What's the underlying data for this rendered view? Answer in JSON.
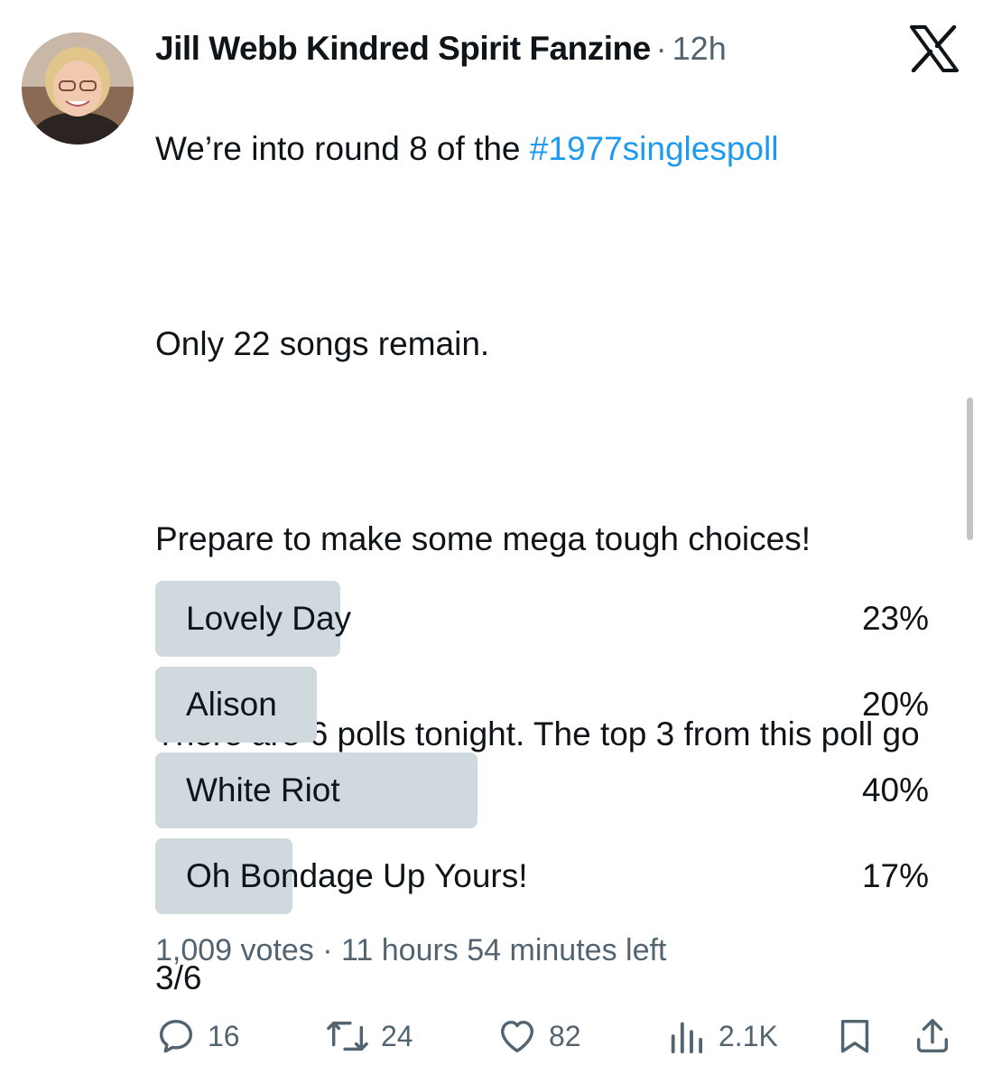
{
  "author": {
    "display_name": "Jill Webb Kindred Spirit Fanzine",
    "separator": "·",
    "time": "12h",
    "avatar_icon": "avatar-photo"
  },
  "tweet": {
    "line1_prefix": "We’re into round 8 of the ",
    "hashtag": "#1977singlespoll",
    "para2": "Only 22 songs remain.",
    "para3": "Prepare to make some mega tough choices!",
    "para4": "There are 6 polls tonight. The top 3 from this poll go forward.",
    "para5": "3/6"
  },
  "poll": {
    "options": [
      {
        "label": "Lovely Day",
        "percent_text": "23%",
        "fraction": 0.23
      },
      {
        "label": "Alison",
        "percent_text": "20%",
        "fraction": 0.2
      },
      {
        "label": "White Riot",
        "percent_text": "40%",
        "fraction": 0.4
      },
      {
        "label": "Oh Bondage Up Yours!",
        "percent_text": "17%",
        "fraction": 0.17
      }
    ],
    "votes": "1,009 votes",
    "meta_separator": " · ",
    "time_left": "11 hours 54 minutes left"
  },
  "actions": {
    "reply_count": "16",
    "retweet_count": "24",
    "like_count": "82",
    "view_count": "2.1K"
  },
  "colors": {
    "accent": "#1d9bf0",
    "text": "#0f1419",
    "muted": "#536471",
    "poll_bar": "#cfd9de"
  },
  "icons": [
    "reply-icon",
    "retweet-icon",
    "like-icon",
    "views-icon",
    "bookmark-icon",
    "share-icon",
    "x-logo-icon"
  ]
}
